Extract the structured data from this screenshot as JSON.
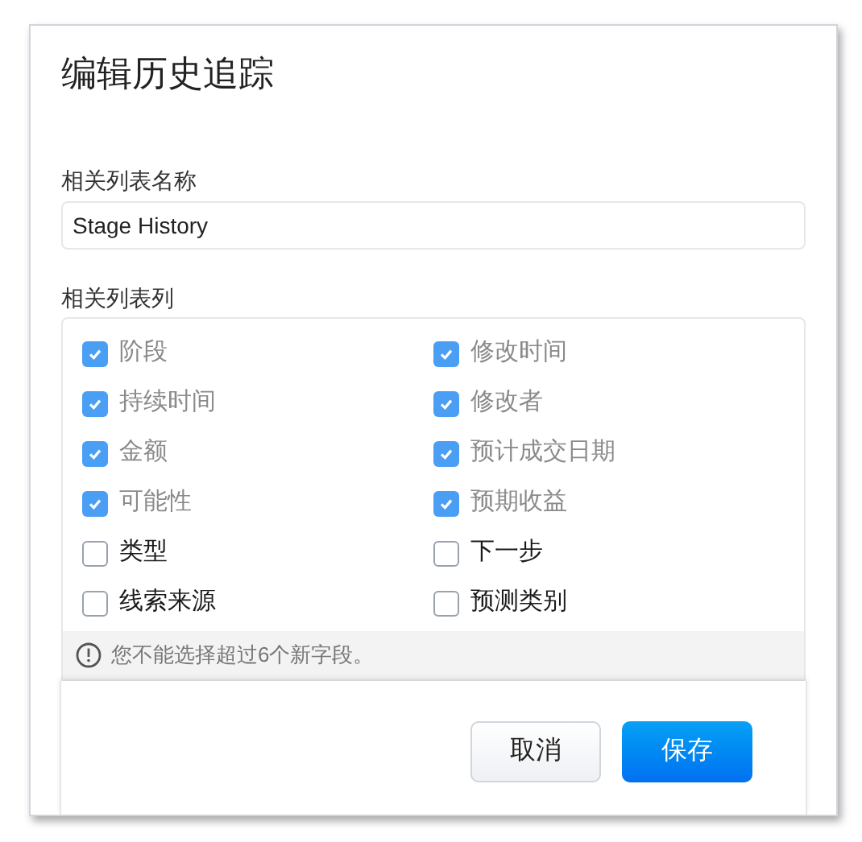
{
  "dialog": {
    "title": "编辑历史追踪"
  },
  "name_field": {
    "label": "相关列表名称",
    "value": "Stage History"
  },
  "columns_section": {
    "label": "相关列表列",
    "options": [
      {
        "label": "阶段",
        "checked": true,
        "disabled": true
      },
      {
        "label": "修改时间",
        "checked": true,
        "disabled": true
      },
      {
        "label": "持续时间",
        "checked": true,
        "disabled": true
      },
      {
        "label": "修改者",
        "checked": true,
        "disabled": true
      },
      {
        "label": "金额",
        "checked": true,
        "disabled": true
      },
      {
        "label": "预计成交日期",
        "checked": true,
        "disabled": true
      },
      {
        "label": "可能性",
        "checked": true,
        "disabled": true
      },
      {
        "label": "预期收益",
        "checked": true,
        "disabled": true
      },
      {
        "label": "类型",
        "checked": false,
        "disabled": false
      },
      {
        "label": "下一步",
        "checked": false,
        "disabled": false
      },
      {
        "label": "线索来源",
        "checked": false,
        "disabled": false
      },
      {
        "label": "预测类别",
        "checked": false,
        "disabled": false
      }
    ],
    "notice": "您不能选择超过6个新字段。"
  },
  "buttons": [
    {
      "label": "取消",
      "kind": "secondary"
    },
    {
      "label": "保存",
      "kind": "primary"
    }
  ]
}
